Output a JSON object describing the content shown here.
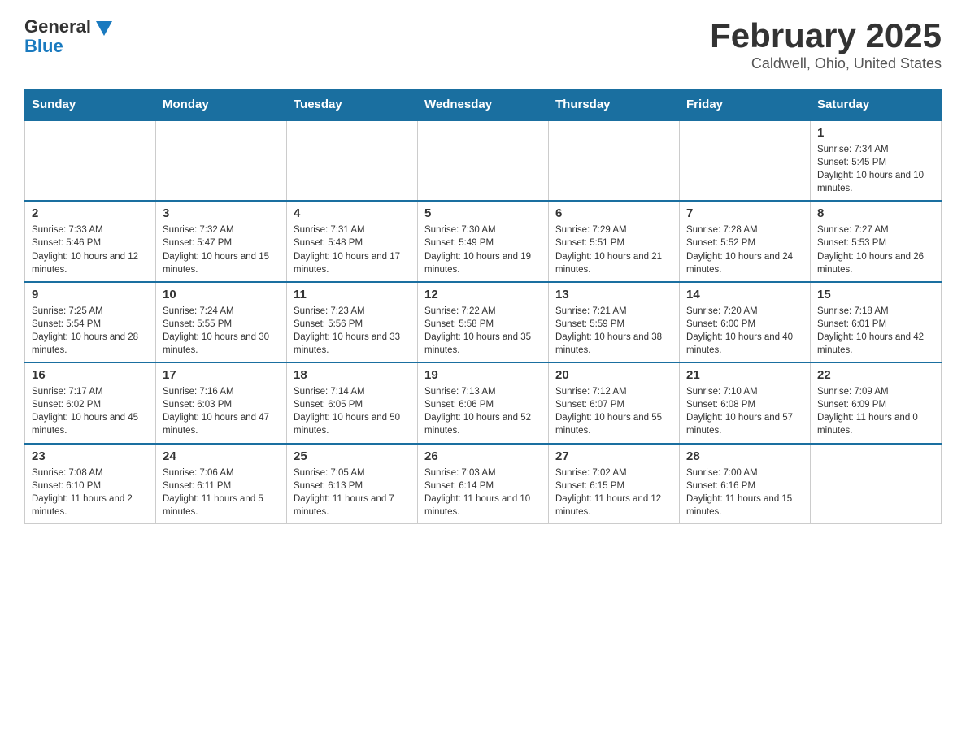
{
  "header": {
    "logo_general": "General",
    "logo_blue": "Blue",
    "title": "February 2025",
    "location": "Caldwell, Ohio, United States"
  },
  "days_of_week": [
    "Sunday",
    "Monday",
    "Tuesday",
    "Wednesday",
    "Thursday",
    "Friday",
    "Saturday"
  ],
  "weeks": [
    [
      {
        "day": "",
        "sunrise": "",
        "sunset": "",
        "daylight": "",
        "empty": true
      },
      {
        "day": "",
        "sunrise": "",
        "sunset": "",
        "daylight": "",
        "empty": true
      },
      {
        "day": "",
        "sunrise": "",
        "sunset": "",
        "daylight": "",
        "empty": true
      },
      {
        "day": "",
        "sunrise": "",
        "sunset": "",
        "daylight": "",
        "empty": true
      },
      {
        "day": "",
        "sunrise": "",
        "sunset": "",
        "daylight": "",
        "empty": true
      },
      {
        "day": "",
        "sunrise": "",
        "sunset": "",
        "daylight": "",
        "empty": true
      },
      {
        "day": "1",
        "sunrise": "Sunrise: 7:34 AM",
        "sunset": "Sunset: 5:45 PM",
        "daylight": "Daylight: 10 hours and 10 minutes.",
        "empty": false
      }
    ],
    [
      {
        "day": "2",
        "sunrise": "Sunrise: 7:33 AM",
        "sunset": "Sunset: 5:46 PM",
        "daylight": "Daylight: 10 hours and 12 minutes.",
        "empty": false
      },
      {
        "day": "3",
        "sunrise": "Sunrise: 7:32 AM",
        "sunset": "Sunset: 5:47 PM",
        "daylight": "Daylight: 10 hours and 15 minutes.",
        "empty": false
      },
      {
        "day": "4",
        "sunrise": "Sunrise: 7:31 AM",
        "sunset": "Sunset: 5:48 PM",
        "daylight": "Daylight: 10 hours and 17 minutes.",
        "empty": false
      },
      {
        "day": "5",
        "sunrise": "Sunrise: 7:30 AM",
        "sunset": "Sunset: 5:49 PM",
        "daylight": "Daylight: 10 hours and 19 minutes.",
        "empty": false
      },
      {
        "day": "6",
        "sunrise": "Sunrise: 7:29 AM",
        "sunset": "Sunset: 5:51 PM",
        "daylight": "Daylight: 10 hours and 21 minutes.",
        "empty": false
      },
      {
        "day": "7",
        "sunrise": "Sunrise: 7:28 AM",
        "sunset": "Sunset: 5:52 PM",
        "daylight": "Daylight: 10 hours and 24 minutes.",
        "empty": false
      },
      {
        "day": "8",
        "sunrise": "Sunrise: 7:27 AM",
        "sunset": "Sunset: 5:53 PM",
        "daylight": "Daylight: 10 hours and 26 minutes.",
        "empty": false
      }
    ],
    [
      {
        "day": "9",
        "sunrise": "Sunrise: 7:25 AM",
        "sunset": "Sunset: 5:54 PM",
        "daylight": "Daylight: 10 hours and 28 minutes.",
        "empty": false
      },
      {
        "day": "10",
        "sunrise": "Sunrise: 7:24 AM",
        "sunset": "Sunset: 5:55 PM",
        "daylight": "Daylight: 10 hours and 30 minutes.",
        "empty": false
      },
      {
        "day": "11",
        "sunrise": "Sunrise: 7:23 AM",
        "sunset": "Sunset: 5:56 PM",
        "daylight": "Daylight: 10 hours and 33 minutes.",
        "empty": false
      },
      {
        "day": "12",
        "sunrise": "Sunrise: 7:22 AM",
        "sunset": "Sunset: 5:58 PM",
        "daylight": "Daylight: 10 hours and 35 minutes.",
        "empty": false
      },
      {
        "day": "13",
        "sunrise": "Sunrise: 7:21 AM",
        "sunset": "Sunset: 5:59 PM",
        "daylight": "Daylight: 10 hours and 38 minutes.",
        "empty": false
      },
      {
        "day": "14",
        "sunrise": "Sunrise: 7:20 AM",
        "sunset": "Sunset: 6:00 PM",
        "daylight": "Daylight: 10 hours and 40 minutes.",
        "empty": false
      },
      {
        "day": "15",
        "sunrise": "Sunrise: 7:18 AM",
        "sunset": "Sunset: 6:01 PM",
        "daylight": "Daylight: 10 hours and 42 minutes.",
        "empty": false
      }
    ],
    [
      {
        "day": "16",
        "sunrise": "Sunrise: 7:17 AM",
        "sunset": "Sunset: 6:02 PM",
        "daylight": "Daylight: 10 hours and 45 minutes.",
        "empty": false
      },
      {
        "day": "17",
        "sunrise": "Sunrise: 7:16 AM",
        "sunset": "Sunset: 6:03 PM",
        "daylight": "Daylight: 10 hours and 47 minutes.",
        "empty": false
      },
      {
        "day": "18",
        "sunrise": "Sunrise: 7:14 AM",
        "sunset": "Sunset: 6:05 PM",
        "daylight": "Daylight: 10 hours and 50 minutes.",
        "empty": false
      },
      {
        "day": "19",
        "sunrise": "Sunrise: 7:13 AM",
        "sunset": "Sunset: 6:06 PM",
        "daylight": "Daylight: 10 hours and 52 minutes.",
        "empty": false
      },
      {
        "day": "20",
        "sunrise": "Sunrise: 7:12 AM",
        "sunset": "Sunset: 6:07 PM",
        "daylight": "Daylight: 10 hours and 55 minutes.",
        "empty": false
      },
      {
        "day": "21",
        "sunrise": "Sunrise: 7:10 AM",
        "sunset": "Sunset: 6:08 PM",
        "daylight": "Daylight: 10 hours and 57 minutes.",
        "empty": false
      },
      {
        "day": "22",
        "sunrise": "Sunrise: 7:09 AM",
        "sunset": "Sunset: 6:09 PM",
        "daylight": "Daylight: 11 hours and 0 minutes.",
        "empty": false
      }
    ],
    [
      {
        "day": "23",
        "sunrise": "Sunrise: 7:08 AM",
        "sunset": "Sunset: 6:10 PM",
        "daylight": "Daylight: 11 hours and 2 minutes.",
        "empty": false
      },
      {
        "day": "24",
        "sunrise": "Sunrise: 7:06 AM",
        "sunset": "Sunset: 6:11 PM",
        "daylight": "Daylight: 11 hours and 5 minutes.",
        "empty": false
      },
      {
        "day": "25",
        "sunrise": "Sunrise: 7:05 AM",
        "sunset": "Sunset: 6:13 PM",
        "daylight": "Daylight: 11 hours and 7 minutes.",
        "empty": false
      },
      {
        "day": "26",
        "sunrise": "Sunrise: 7:03 AM",
        "sunset": "Sunset: 6:14 PM",
        "daylight": "Daylight: 11 hours and 10 minutes.",
        "empty": false
      },
      {
        "day": "27",
        "sunrise": "Sunrise: 7:02 AM",
        "sunset": "Sunset: 6:15 PM",
        "daylight": "Daylight: 11 hours and 12 minutes.",
        "empty": false
      },
      {
        "day": "28",
        "sunrise": "Sunrise: 7:00 AM",
        "sunset": "Sunset: 6:16 PM",
        "daylight": "Daylight: 11 hours and 15 minutes.",
        "empty": false
      },
      {
        "day": "",
        "sunrise": "",
        "sunset": "",
        "daylight": "",
        "empty": true
      }
    ]
  ]
}
